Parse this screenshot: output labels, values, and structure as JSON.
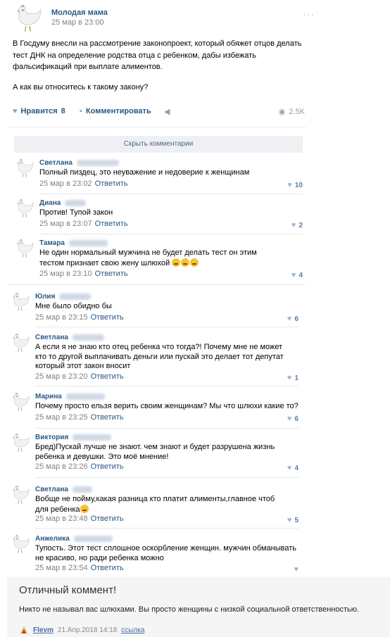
{
  "post": {
    "author": "Молодая мама",
    "date": "25 мар в 23:00",
    "more": "···",
    "text_p1": "В Госдуму внесли на рассмотрение законопроект, который обяжет отцов делать тест ДНК на определение родства отца с ребенком, дабы избежать фальсификаций при выплате алиментов.",
    "text_p2": "А как вы относитесь к такому закону?",
    "like_label": "Нравится",
    "like_count": "8",
    "comment_label": "Комментировать",
    "views": "2.5K"
  },
  "hide_comments_label": "Скрыть комментарии",
  "comments": [
    {
      "name": "Светлана",
      "text": "Полный пиздец, это неуважение и недоверие к женщинам",
      "date": "25 мар в 23:02",
      "reply": "Ответить",
      "likes": "10"
    },
    {
      "name": "Диана",
      "text": "Против! Тупой закон",
      "date": "25 мар в 23:07",
      "reply": "Ответить",
      "likes": "2"
    },
    {
      "name": "Тамара",
      "text": "Не один нормальный мужчина не будет делать тест он этим тестом признает свою жену шлюхой",
      "date": "25 мар в 23:10",
      "reply": "Ответить",
      "likes": "4"
    },
    {
      "name": "Юлия",
      "text": "Мне было обидно бы",
      "date": "25 мар в 23:15",
      "reply": "Ответить",
      "likes": "6"
    },
    {
      "name": "Светлана",
      "text": "А если я не знаю кто отец ребенка что тогда?! Почему мне не может кто то другой выплачивать деньги или пускай это делает тот депутат который этот закон вносит",
      "date": "25 мар в 23:20",
      "reply": "Ответить",
      "likes": "1"
    },
    {
      "name": "Марина",
      "text": "Почему просто ельзя верить своим женщинам? Мы что шлюхи какие то?",
      "date": "25 мар в 23:25",
      "reply": "Ответить",
      "likes": "6"
    },
    {
      "name": "Виктория",
      "text": "Бред)Пускай лучше не знают. чем знают и будет разрушена жизнь ребенка и девушки. Это моё мнение!",
      "date": "25 мар в 23:26",
      "reply": "Ответить",
      "likes": "4"
    },
    {
      "name": "Светлана",
      "text": "Вобще не пойму,какая разница кто платит алименты,главное чтоб для ребенка",
      "date": "25 мар в 23:48",
      "reply": "Ответить",
      "likes": "5"
    },
    {
      "name": "Анжелика",
      "text": "Тупость. Этот тест сплошное оскорбление женщин. мужчин обманывать не красиво, но ради ребенка можно",
      "date": "25 мар в 23:54",
      "reply": "Ответить",
      "likes": ""
    }
  ],
  "footer": {
    "title": "Отличный коммент!",
    "text": "Никто не называл вас шлюхами. Вы просто женщины с низкой социальной ответственностью.",
    "user": "Fleym",
    "date": "21.Апр.2018 14:18",
    "link": "ссылка"
  },
  "colors": {
    "link": "#2a5885",
    "muted": "#828282",
    "bg_panel": "#eef0f3"
  }
}
